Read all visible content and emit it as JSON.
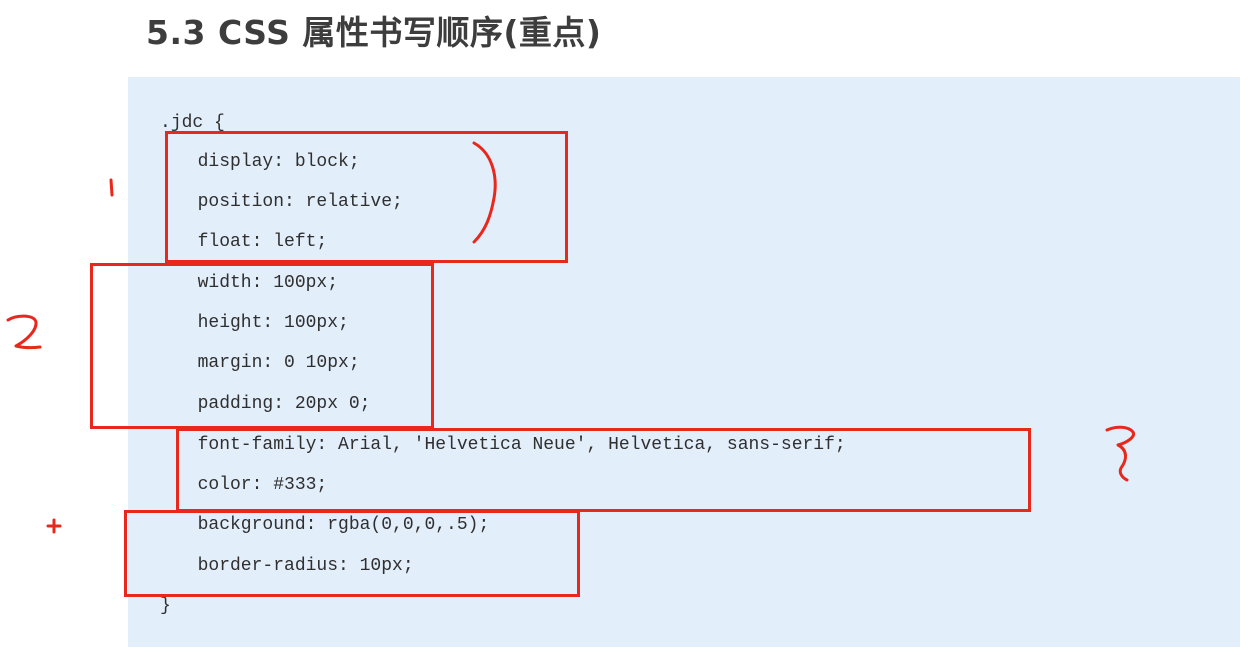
{
  "heading": {
    "title": "5.3 CSS 属性书写顺序(重点)"
  },
  "code": {
    "lines": [
      ".jdc {",
      "  display: block;",
      "  position: relative;",
      "  float: left;",
      "  width: 100px;",
      "  height: 100px;",
      "  margin: 0 10px;",
      "  padding: 20px 0;",
      "  font-family: Arial, 'Helvetica Neue', Helvetica, sans-serif;",
      "  color: #333;",
      "  background: rgba(0,0,0,.5);",
      "  border-radius: 10px;",
      "}"
    ]
  },
  "annotations": {
    "ink_color": "#e8281c",
    "group_marks": [
      "1",
      "2",
      "3",
      "+"
    ]
  },
  "colors": {
    "code_background": "#e3eefb",
    "title_text": "#3d3d3d",
    "code_text": "#2f2f2f"
  }
}
